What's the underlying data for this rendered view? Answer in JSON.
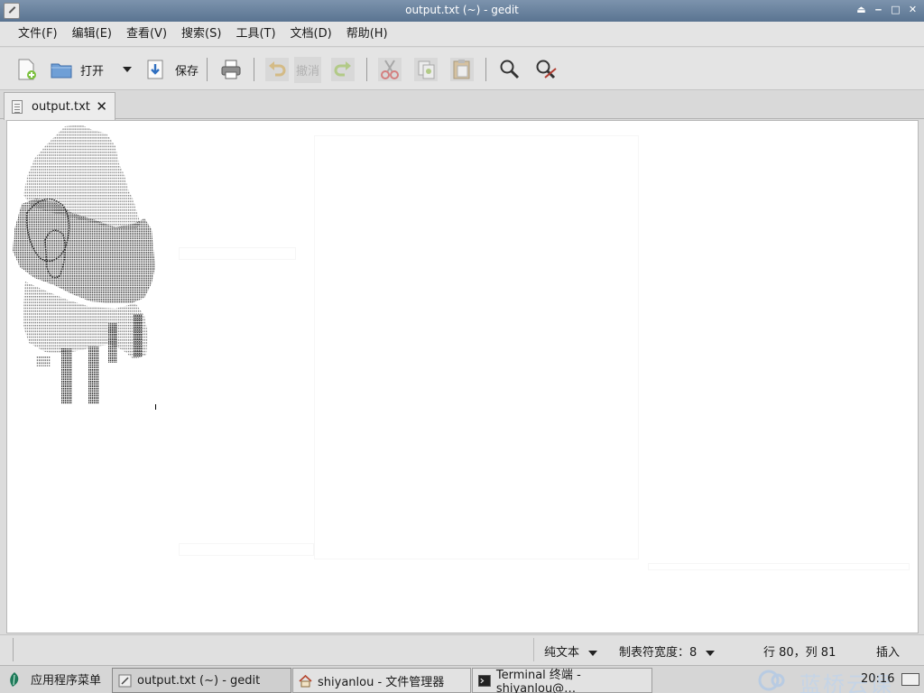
{
  "window": {
    "title": "output.txt (~) - gedit",
    "controls": [
      "⏏",
      "‒",
      "□",
      "✕"
    ]
  },
  "menubar": {
    "items": [
      "文件(F)",
      "编辑(E)",
      "查看(V)",
      "搜索(S)",
      "工具(T)",
      "文档(D)",
      "帮助(H)"
    ]
  },
  "toolbar": {
    "open_label": "打开",
    "save_label": "保存",
    "undo_label": "撤消"
  },
  "tab": {
    "label": "output.txt",
    "close": "✕"
  },
  "statusbar": {
    "language": "纯文本",
    "tab_width": "制表符宽度：8",
    "cursor": "行 80，列 81",
    "mode": "插入"
  },
  "taskbar": {
    "start_label": "应用程序菜单",
    "tasks": [
      {
        "label": "output.txt (~) - gedit"
      },
      {
        "label": "shiyanlou - 文件管理器"
      },
      {
        "label": "Terminal 终端 - shiyanlou@…"
      }
    ],
    "brand": "蓝桥云课",
    "clock": "20:16"
  }
}
